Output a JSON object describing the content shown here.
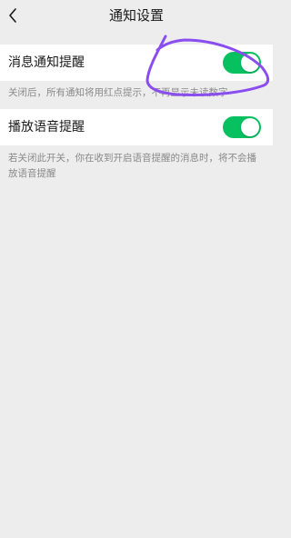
{
  "nav": {
    "title": "通知设置",
    "back_icon": "chevron-left-icon"
  },
  "settings": [
    {
      "label": "消息通知提醒",
      "enabled": true,
      "note": "关闭后，所有通知将用红点提示，不再显示未读数字"
    },
    {
      "label": "播放语音提醒",
      "enabled": true,
      "note": "若关闭此开关，你在收到开启语音提醒的消息时，将不会播放语音提醒"
    }
  ],
  "colors": {
    "toggle_on": "#07c160",
    "background": "#ededed",
    "annotation_stroke": "#8a4df0"
  }
}
